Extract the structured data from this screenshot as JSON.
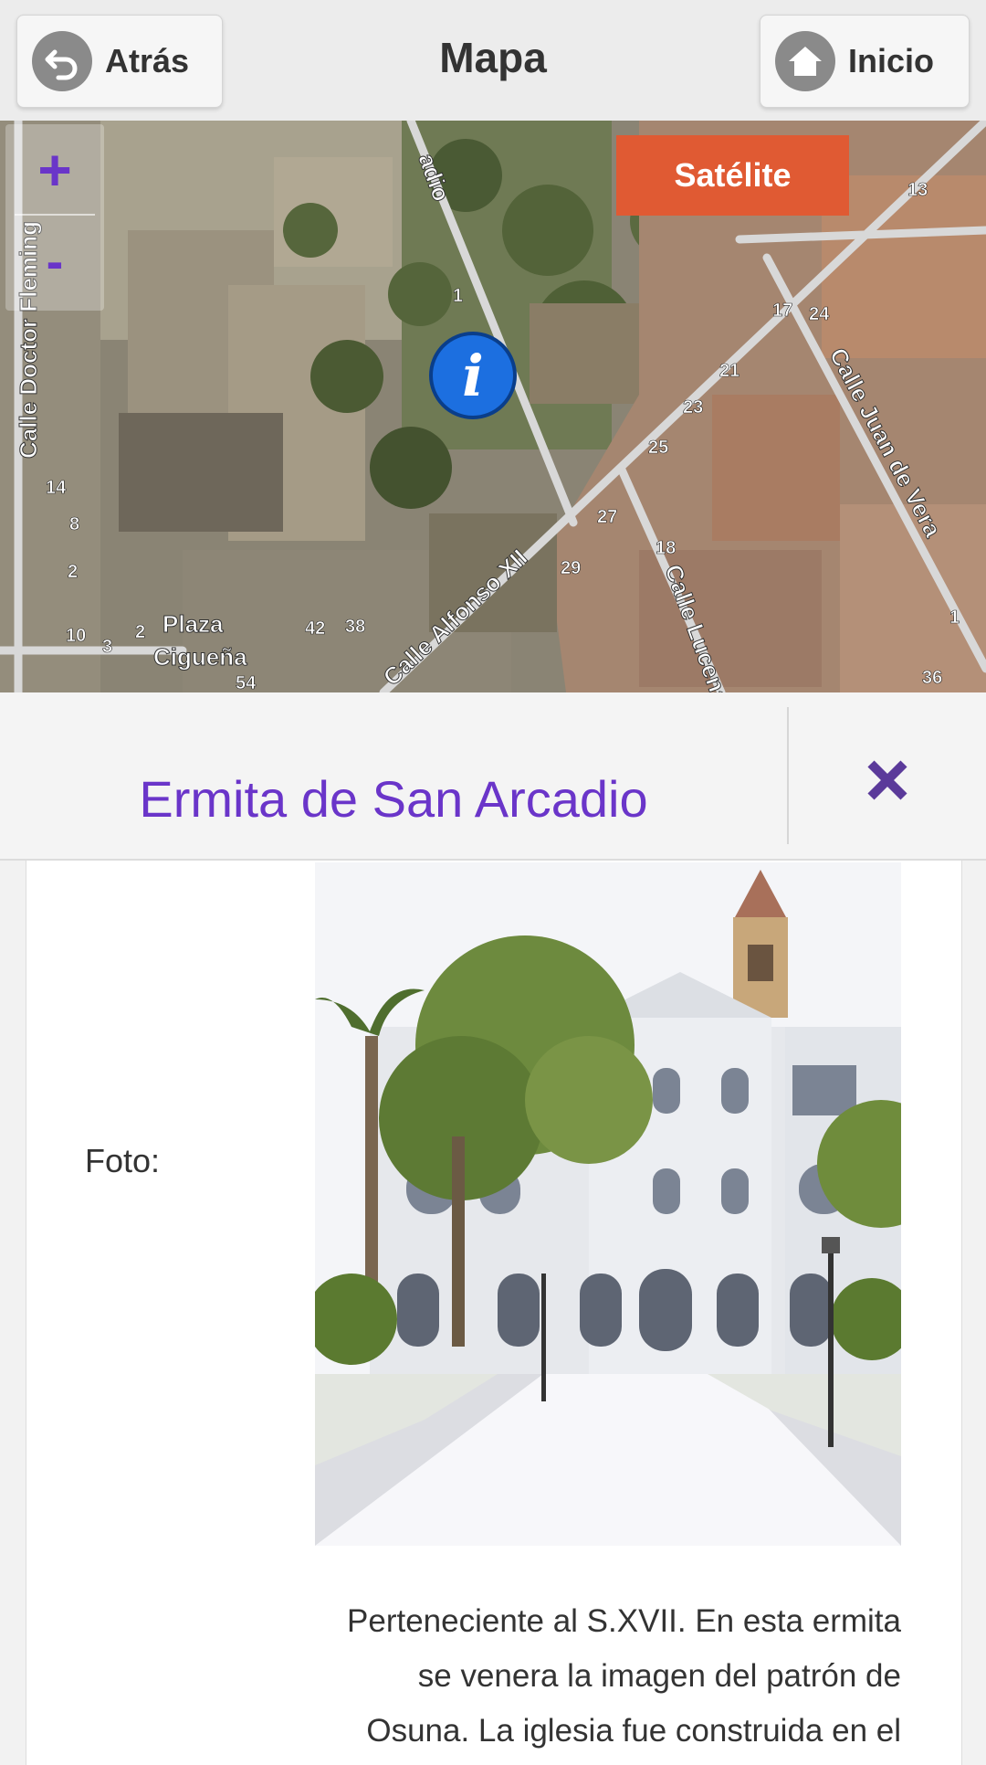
{
  "header": {
    "back_label": "Atrás",
    "title": "Mapa",
    "home_label": "Inicio"
  },
  "map": {
    "zoom_in": "+",
    "zoom_out": "-",
    "layer_button": "Satélite",
    "marker_symbol": "i",
    "labels": {
      "doctor_fleming": "Calle Doctor Fleming",
      "arcadio": "adio",
      "plaza": "Plaza",
      "ciguena": "Cigueña",
      "alfonso": "Calle Alfonso XII",
      "lucena": "Calle Lucena",
      "juan_vera": "Calle Juan de Vera"
    },
    "numbers": [
      "1",
      "14",
      "8",
      "2",
      "10",
      "3",
      "2",
      "42",
      "38",
      "54",
      "27",
      "29",
      "18",
      "25",
      "23",
      "21",
      "17",
      "24",
      "13",
      "1",
      "36"
    ]
  },
  "popup": {
    "title": "Ermita de San Arcadio",
    "photo_label": "Foto:",
    "description": "Perteneciente al S.XVII. En esta ermita se venera la imagen del patrón de Osuna. La iglesia fue construida en el"
  },
  "colors": {
    "accent": "#6a35c9",
    "satellite_button": "#e05a33",
    "marker": "#1c6fe0"
  }
}
